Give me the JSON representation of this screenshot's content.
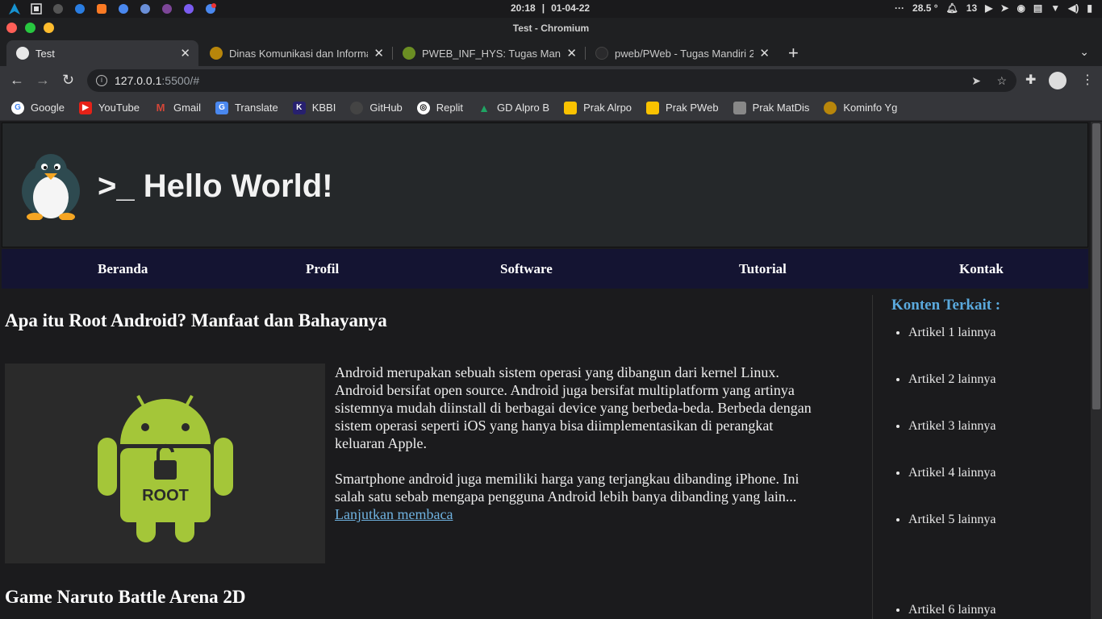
{
  "system": {
    "time": "20:18",
    "separator": "|",
    "date": "01-04-22",
    "temperature": "28.5 °",
    "notification_count": "13",
    "dots": "···"
  },
  "window": {
    "title": "Test - Chromium"
  },
  "tabs": [
    {
      "title": "Test",
      "active": true
    },
    {
      "title": "Dinas Komunikasi dan Informa",
      "active": false
    },
    {
      "title": "PWEB_INF_HYS: Tugas Mandiri",
      "active": false
    },
    {
      "title": "pweb/PWeb - Tugas Mandiri 2",
      "active": false
    }
  ],
  "address": {
    "host": "127.0.0.1",
    "path": ":5500/#"
  },
  "bookmarks": [
    {
      "label": "Google",
      "color": "#ffffff"
    },
    {
      "label": "YouTube",
      "color": "#e62117"
    },
    {
      "label": "Gmail",
      "color": "#d44638"
    },
    {
      "label": "Translate",
      "color": "#4a88ef"
    },
    {
      "label": "KBBI",
      "color": "#27206f"
    },
    {
      "label": "GitHub",
      "color": "#444"
    },
    {
      "label": "Replit",
      "color": "#111"
    },
    {
      "label": "GD Alpro B",
      "color": "#1fa463"
    },
    {
      "label": "Prak Alrpo",
      "color": "#f9c200"
    },
    {
      "label": "Prak PWeb",
      "color": "#f9c200"
    },
    {
      "label": "Prak MatDis",
      "color": "#888"
    },
    {
      "label": "Kominfo Yg",
      "color": "#b8860b"
    }
  ],
  "site": {
    "title": ">_ Hello World!",
    "menu": [
      "Beranda",
      "Profil",
      "Software",
      "Tutorial",
      "Kontak"
    ]
  },
  "articles": [
    {
      "title": "Apa itu Root Android? Manfaat dan Bahayanya",
      "image_label": "ROOT",
      "paragraph1": "Android merupakan sebuah sistem operasi yang dibangun dari kernel Linux. Android bersifat open source. Android juga bersifat multiplatform yang artinya sistemnya mudah diinstall di berbagai device yang berbeda-beda. Berbeda dengan sistem operasi seperti iOS yang hanya bisa diimplementasikan di perangkat keluaran Apple.",
      "paragraph2": "Smartphone android juga memiliki harga yang terjangkau dibanding iPhone. Ini salah satu sebab mengapa pengguna Android lebih banya dibanding yang lain...",
      "read_more": "Lanjutkan membaca"
    },
    {
      "title": "Game Naruto Battle Arena 2D"
    }
  ],
  "aside": {
    "title": "Konten Terkait :",
    "items": [
      "Artikel 1 lainnya",
      "Artikel 2 lainnya",
      "Artikel 3 lainnya",
      "Artikel 4 lainnya",
      "Artikel 5 lainnya",
      "Artikel 6 lainnya"
    ]
  }
}
